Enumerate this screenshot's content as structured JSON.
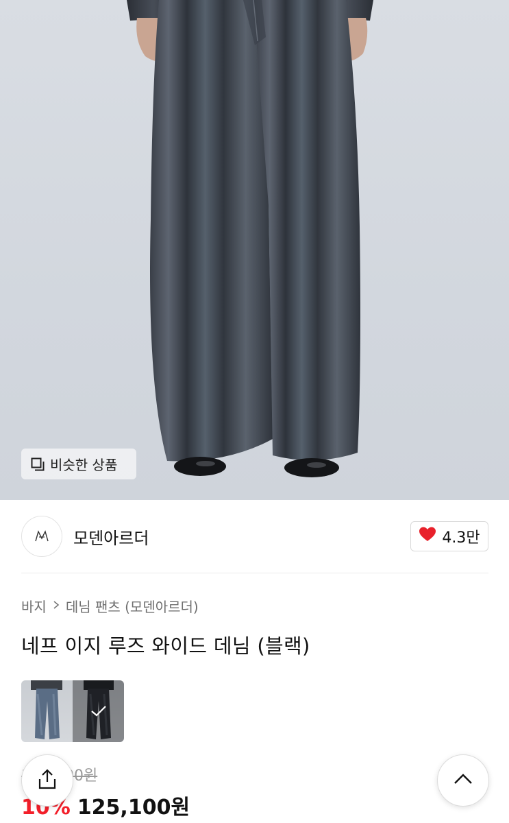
{
  "product_image": {
    "alt_icon": "product-photo"
  },
  "similar_chip": {
    "label": "비슷한 상품",
    "icon": "similar-items-icon"
  },
  "brand": {
    "name": "모덴아르더",
    "logo_icon": "brand-logo-icon"
  },
  "like": {
    "count": "4.3만",
    "icon": "heart-icon",
    "color": "#e8212b"
  },
  "breadcrumb": {
    "category": "바지",
    "sub_category": "데님 팬츠 (모덴아르더)"
  },
  "product": {
    "title": "네프 이지 루즈 와이드 데님 (블랙)"
  },
  "price": {
    "original": "139,000원",
    "discount": "10%",
    "final": "125,100원",
    "discount_color": "#f31f2a"
  },
  "swatches": [
    {
      "name": "blue",
      "selected": false
    },
    {
      "name": "black",
      "selected": true
    }
  ],
  "buttons": {
    "share_icon": "share-icon",
    "top_icon": "chevron-up-icon"
  }
}
